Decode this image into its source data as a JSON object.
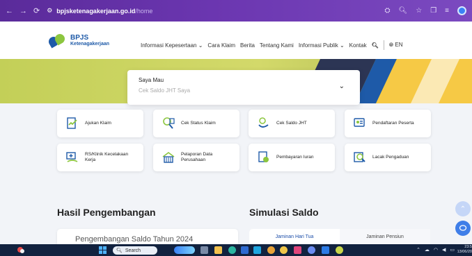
{
  "browser": {
    "nav_back": "←",
    "nav_forward": "→",
    "nav_reload": "⟳",
    "url_domain": "bpjsketenagakerjaan.go.id",
    "url_path": "/home"
  },
  "logo": {
    "line1": "BPJS",
    "line2": "Ketenagakerjaan"
  },
  "menu": {
    "items": [
      "Informasi Kepesertaan ⌄",
      "Cara Klaim",
      "Berita",
      "Tentang Kami",
      "Informasi Publik ⌄",
      "Kontak"
    ],
    "language": "EN"
  },
  "wish": {
    "label": "Saya Mau",
    "value": "Cek Saldo JHT Saya"
  },
  "services": [
    {
      "label": "Ajukan Klaim",
      "icon": "claim-form-icon"
    },
    {
      "label": "Cek Status Klaim",
      "icon": "search-status-icon"
    },
    {
      "label": "Cek Saldo JHT",
      "icon": "money-hand-icon"
    },
    {
      "label": "Pendaftaran Peserta",
      "icon": "id-card-icon"
    },
    {
      "label": "RS/Klinik Kecelakaan Kerja",
      "icon": "hospital-card-icon"
    },
    {
      "label": "Pelaporan Data Perusahaan",
      "icon": "building-icon"
    },
    {
      "label": "Pembayaran Iuran",
      "icon": "payment-icon"
    },
    {
      "label": "Lacak Pengaduan",
      "icon": "track-complaint-icon"
    }
  ],
  "sections": {
    "development_title": "Hasil Pengembangan",
    "development_card": "Pengembangan Saldo Tahun 2024",
    "simulation_title": "Simulasi Saldo",
    "sim_tab_1": "Jaminan Hari Tua",
    "sim_tab_2": "Jaminan Pensiun"
  },
  "taskbar": {
    "search_label": "Search",
    "clock_time": "23:5",
    "clock_date": "13/06/20"
  },
  "colors": {
    "brand_blue": "#1e5aa8",
    "brand_green": "#8cc63f",
    "chrome_purple": "#6b36b0"
  }
}
